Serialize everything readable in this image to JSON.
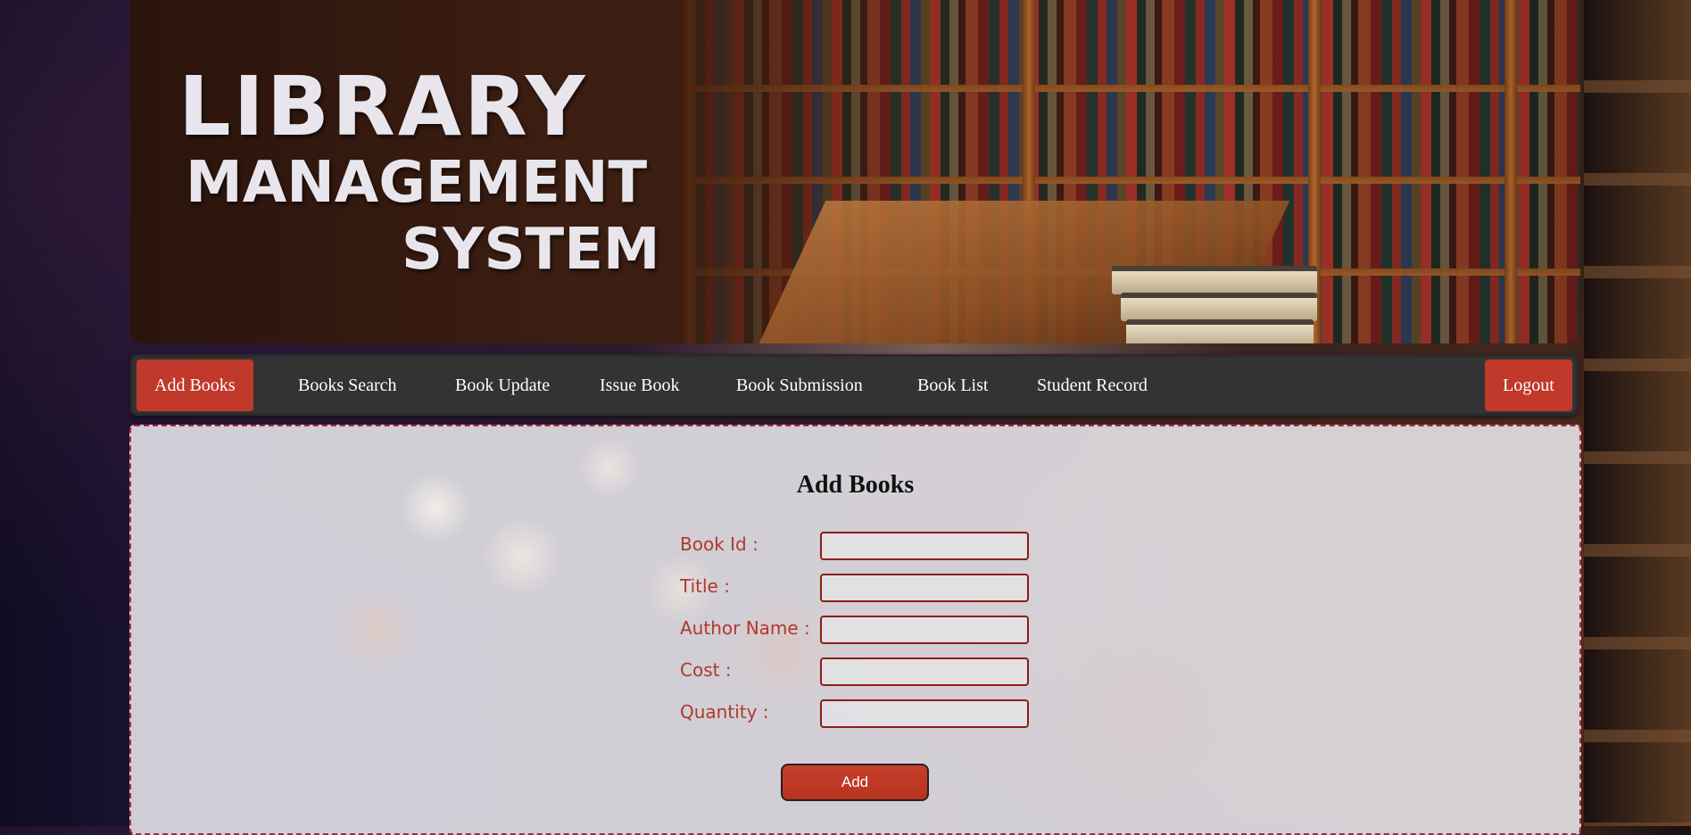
{
  "banner": {
    "title_line1": "LIBRARY",
    "title_line2": "MANAGEMENT",
    "title_line3": "SYSTEM"
  },
  "nav": {
    "items": [
      {
        "label": "Add Books",
        "active": true
      },
      {
        "label": "Books Search",
        "active": false
      },
      {
        "label": "Book Update",
        "active": false
      },
      {
        "label": "Issue Book",
        "active": false
      },
      {
        "label": "Book Submission",
        "active": false
      },
      {
        "label": "Book List",
        "active": false
      },
      {
        "label": "Student Record",
        "active": false
      }
    ],
    "logout_label": "Logout"
  },
  "form": {
    "title": "Add Books",
    "fields": [
      {
        "label": "Book Id :",
        "value": ""
      },
      {
        "label": "Title :",
        "value": ""
      },
      {
        "label": "Author Name :",
        "value": ""
      },
      {
        "label": "Cost :",
        "value": ""
      },
      {
        "label": "Quantity :",
        "value": ""
      }
    ],
    "submit_label": "Add"
  },
  "colors": {
    "accent": "#c0392b",
    "nav_background": "#333333",
    "label_text": "#b0392d",
    "panel_border": "#b0243a"
  }
}
